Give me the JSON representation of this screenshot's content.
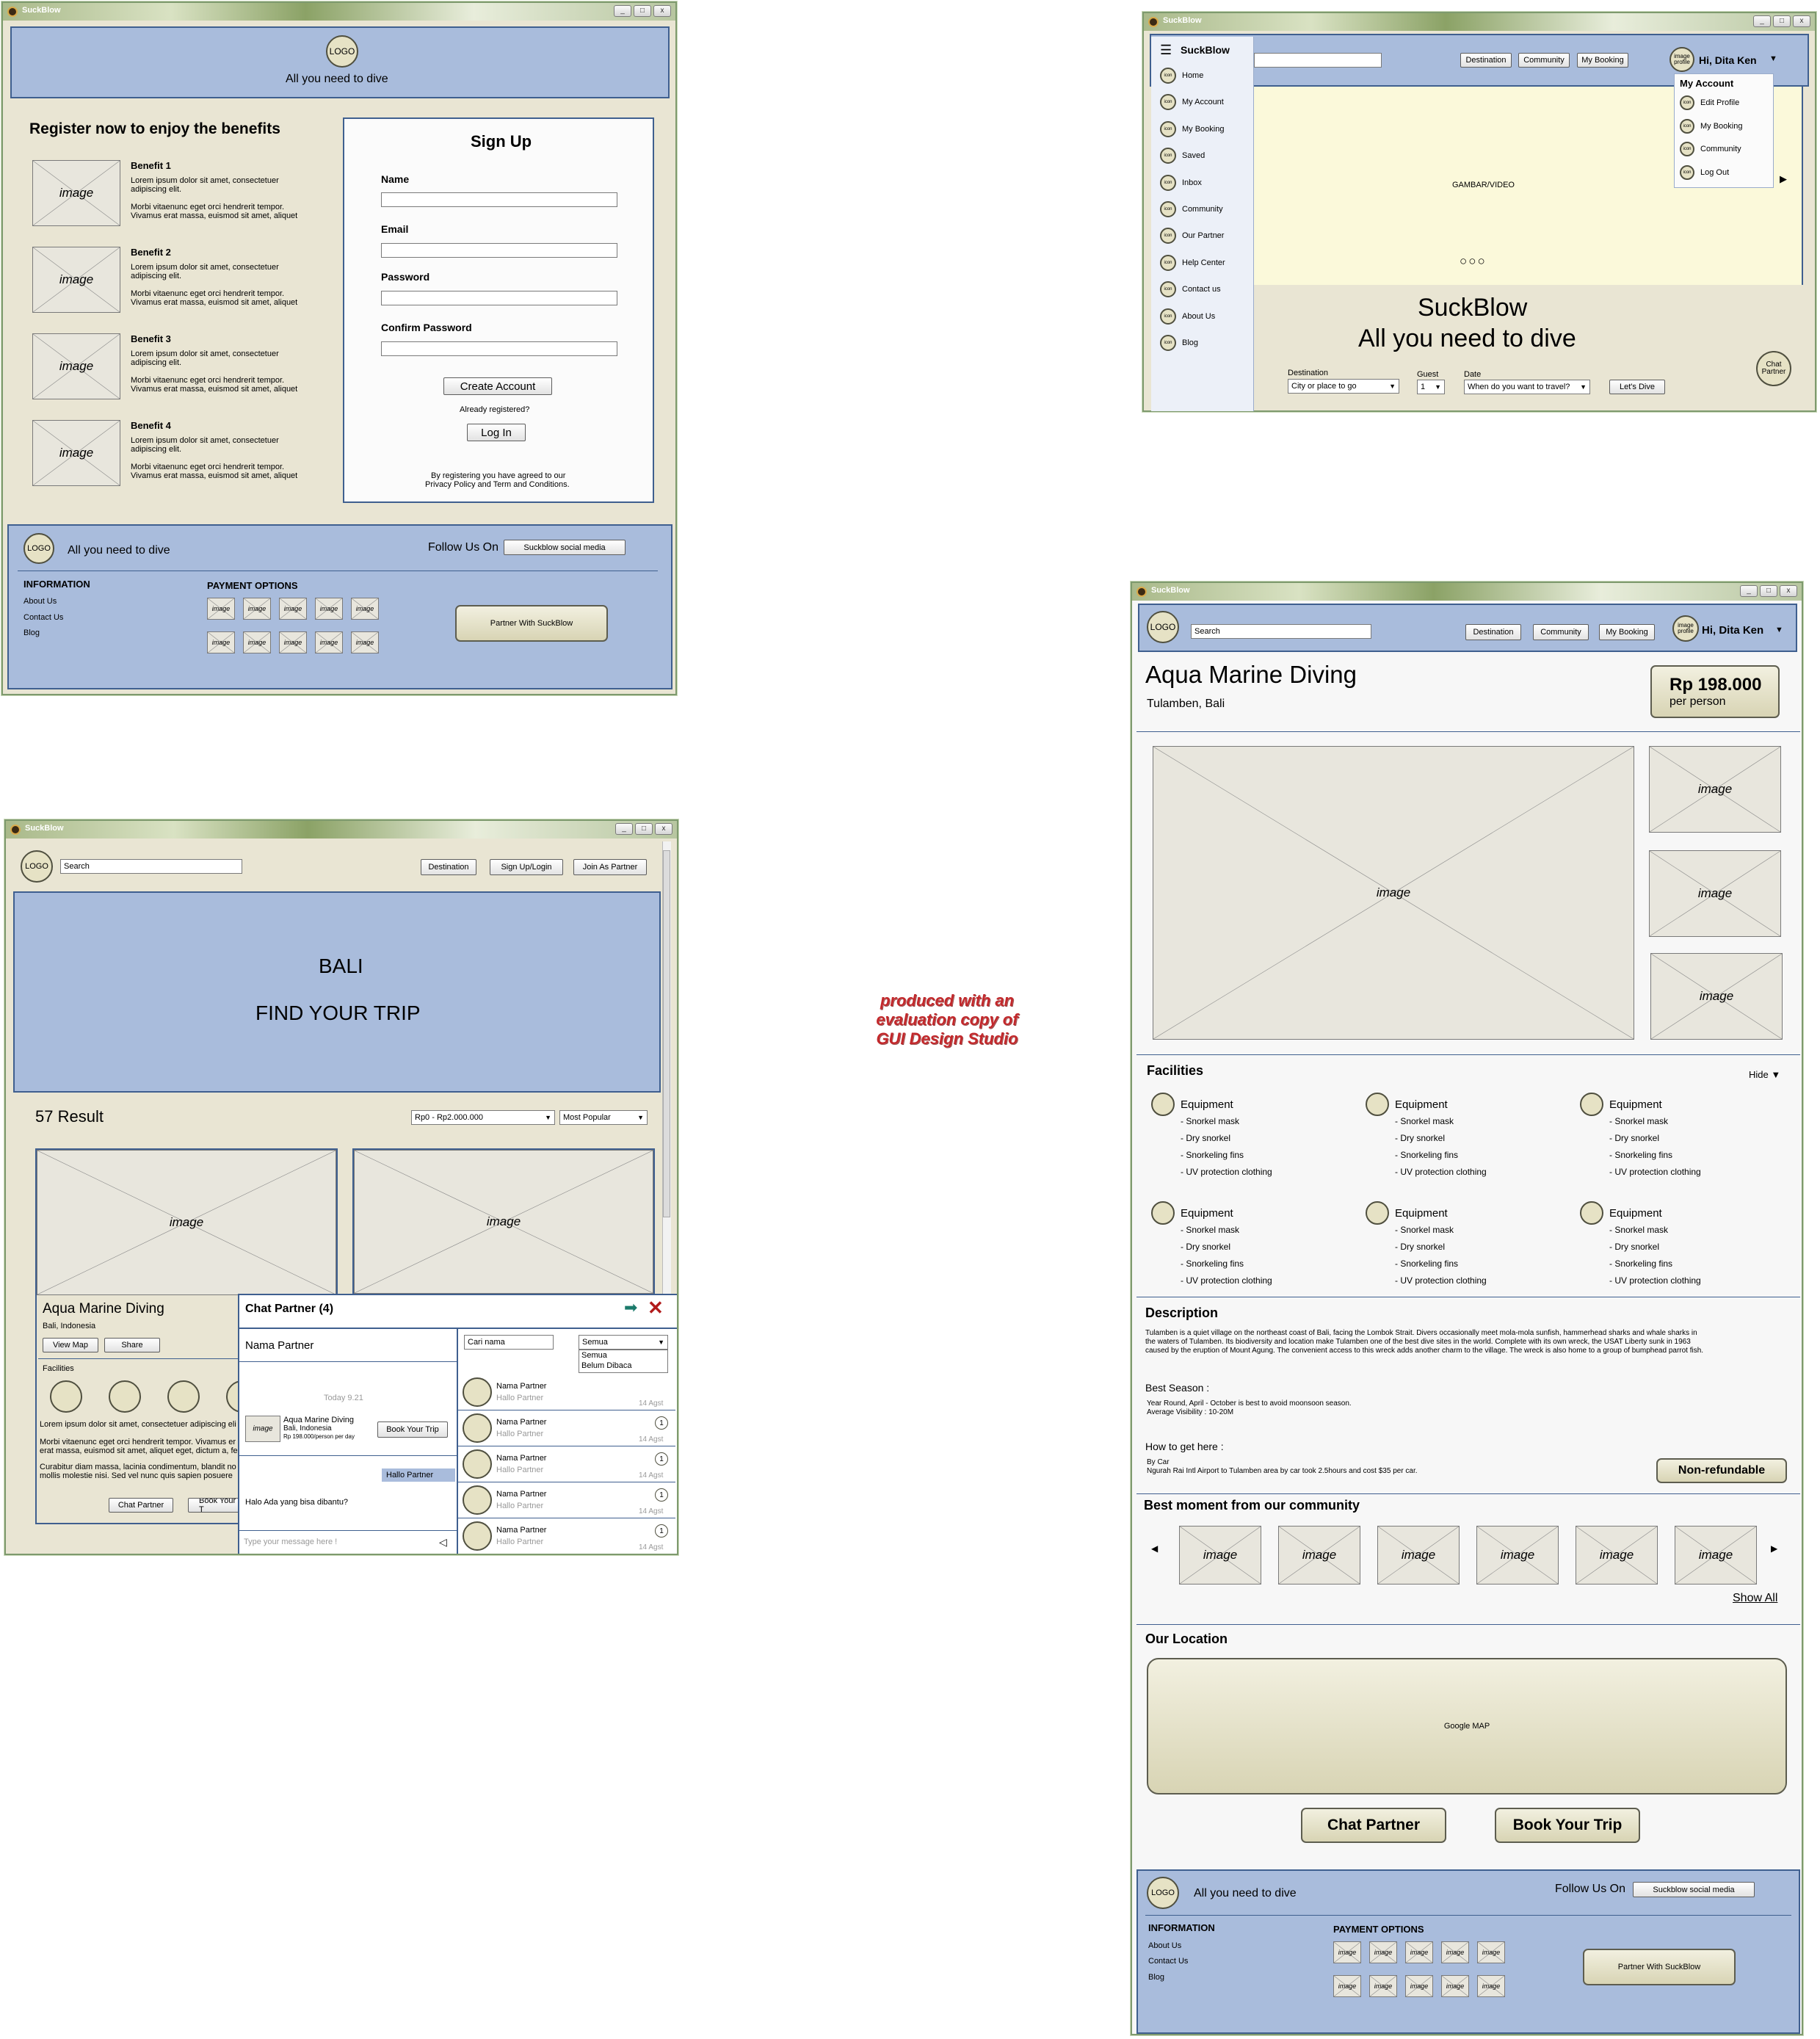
{
  "watermark": [
    "produced with an",
    "evaluation copy of",
    "GUI Design Studio"
  ],
  "common": {
    "app_title": "SuckBlow",
    "logo": "LOGO",
    "tagline": "All you need to dive",
    "image": "image",
    "follow": "Follow Us On",
    "social": "Suckblow social media",
    "information": "INFORMATION",
    "info_links": [
      "About Us",
      "Contact Us",
      "Blog"
    ],
    "payment": "PAYMENT OPTIONS",
    "partner_with": "Partner With SuckBlow",
    "search": "Search",
    "destination": "Destination",
    "community": "Community",
    "my_booking": "My Booking",
    "greeting": "Hi, Dita Ken",
    "image_profile": "image profile",
    "icon": "icon"
  },
  "signup": {
    "heading": "Register now to enjoy the benefits",
    "benefits": [
      {
        "title": "Benefit 1",
        "l1": "Lorem ipsum dolor sit amet, consectetuer",
        "l2": "adipiscing elit.",
        "l3": "Morbi vitaenunc eget orci hendrerit tempor.",
        "l4": "Vivamus erat massa, euismod sit amet, aliquet"
      },
      {
        "title": "Benefit 2",
        "l1": "Lorem ipsum dolor sit amet, consectetuer",
        "l2": "adipiscing elit.",
        "l3": "Morbi vitaenunc eget orci hendrerit tempor.",
        "l4": "Vivamus erat massa, euismod sit amet, aliquet"
      },
      {
        "title": "Benefit 3",
        "l1": "Lorem ipsum dolor sit amet, consectetuer",
        "l2": "adipiscing elit.",
        "l3": "Morbi vitaenunc eget orci hendrerit tempor.",
        "l4": "Vivamus erat massa, euismod sit amet, aliquet"
      },
      {
        "title": "Benefit 4",
        "l1": "Lorem ipsum dolor sit amet, consectetuer",
        "l2": "adipiscing elit.",
        "l3": "Morbi vitaenunc eget orci hendrerit tempor.",
        "l4": "Vivamus erat massa, euismod sit amet, aliquet"
      }
    ],
    "form_title": "Sign Up",
    "name": "Name",
    "email": "Email",
    "password": "Password",
    "confirm": "Confirm Password",
    "create": "Create Account",
    "already": "Already registered?",
    "login": "Log In",
    "terms1": "By registering you have agreed to our",
    "terms2": "Privacy Policy and Term and Conditions."
  },
  "home": {
    "menu_title": "SuckBlow",
    "menu": [
      "Home",
      "My Account",
      "My Booking",
      "Saved",
      "Inbox",
      "Community",
      "Our Partner",
      "Help Center",
      "Contact us",
      "About Us",
      "Blog"
    ],
    "dropdown_title": "My Account",
    "dropdown": [
      "Edit Profile",
      "My Booking",
      "Community",
      "Log Out"
    ],
    "hero": "GAMBAR/VIDEO",
    "title": "SuckBlow",
    "subtitle": "All you need to dive",
    "dest_label": "Destination",
    "dest_value": "City or place to go",
    "guest_label": "Guest",
    "guest_value": "1",
    "date_label": "Date",
    "date_value": "When do you want to travel?",
    "go": "Let's Dive",
    "chat": "Chat Partner"
  },
  "results": {
    "signup": "Sign Up/Login",
    "join": "Join As Partner",
    "banner1": "BALI",
    "banner2": "FIND YOUR TRIP",
    "count": "57 Result",
    "price_filter": "Rp0 - Rp2.000.000",
    "sort": "Most Popular",
    "card_title": "Aqua Marine Diving",
    "card_loc": "Bali, Indonesia",
    "view_map": "View Map",
    "share": "Share",
    "facilities": "Facilities",
    "lorem1": "Lorem ipsum dolor sit amet, consectetuer adipiscing eli",
    "lorem2": "Morbi vitaenunc eget orci hendrerit tempor. Vivamus er",
    "lorem3": "erat massa, euismod sit amet, aliquet eget, dictum a, felis.",
    "lorem4": "Curabitur diam massa, lacinia condimentum, blandit no",
    "lorem5": "mollis molestie nisi. Sed vel nunc quis sapien posuere",
    "chat_partner": "Chat Partner",
    "book": "Book Your T"
  },
  "chat": {
    "title": "Chat Partner (4)",
    "partner": "Nama Partner",
    "today": "Today 9.21",
    "item_title": "Aqua Marine Diving",
    "item_loc": "Bali, Indonesia",
    "item_price": "Rp 198.000/person per day",
    "book": "Book Your Trip",
    "reply": "Hallo Partner",
    "msg": "Halo Ada yang bisa dibantu?",
    "type": "Type your message here !",
    "search": "Cari nama",
    "filter": "Semua",
    "filter_opts": [
      "Semua",
      "Belum Dibaca"
    ],
    "list": [
      {
        "name": "Nama Partner",
        "msg": "Hallo Partner",
        "date": "14 Agst",
        "count": ""
      },
      {
        "name": "Nama Partner",
        "msg": "Hallo Partner",
        "date": "14 Agst",
        "count": "1"
      },
      {
        "name": "Nama Partner",
        "msg": "Hallo Partner",
        "date": "14 Agst",
        "count": "1"
      },
      {
        "name": "Nama Partner",
        "msg": "Hallo Partner",
        "date": "14 Agst",
        "count": "1"
      },
      {
        "name": "Nama Partner",
        "msg": "Hallo Partner",
        "date": "14 Agst",
        "count": "1"
      }
    ]
  },
  "detail": {
    "title": "Aqua Marine Diving",
    "location": "Tulamben, Bali",
    "price": "Rp 198.000",
    "per": "per person",
    "facilities": "Facilities",
    "hide": "Hide",
    "equipment": "Equipment",
    "equip_items": [
      "- Snorkel mask",
      "- Dry snorkel",
      "- Snorkeling fins",
      "- UV protection clothing"
    ],
    "description": "Description",
    "desc1": "Tulamben is a quiet village on the northeast coast of Bali, facing the Lombok Strait. Divers occasionally meet mola-mola sunfish, hammerhead sharks and whale sharks in",
    "desc2": "the waters of Tulamben. Its biodiversity and location make Tulamben one of the best dive sites in the world. Complete with its own wreck, the USAT Liberty sunk in 1963",
    "desc3": "caused by the eruption of Mount Agung. The convenient access to this wreck adds another charm to the village. The wreck is also home to a group of bumphead parrot fish.",
    "best_season": "Best Season :",
    "season1": "Year Round, April - October is best to avoid moonsoon season.",
    "season2": "Average Visibility : 10-20M",
    "how": "How to get here :",
    "by_car": "By Car",
    "route": "Ngurah Rai Intl Airport to Tulamben area by car took 2.5hours and cost $35 per car.",
    "refund": "Non-refundable",
    "moments": "Best moment from our community",
    "show_all": "Show All",
    "location_title": "Our Location",
    "map": "Google MAP",
    "chat": "Chat Partner",
    "book": "Book Your Trip"
  }
}
